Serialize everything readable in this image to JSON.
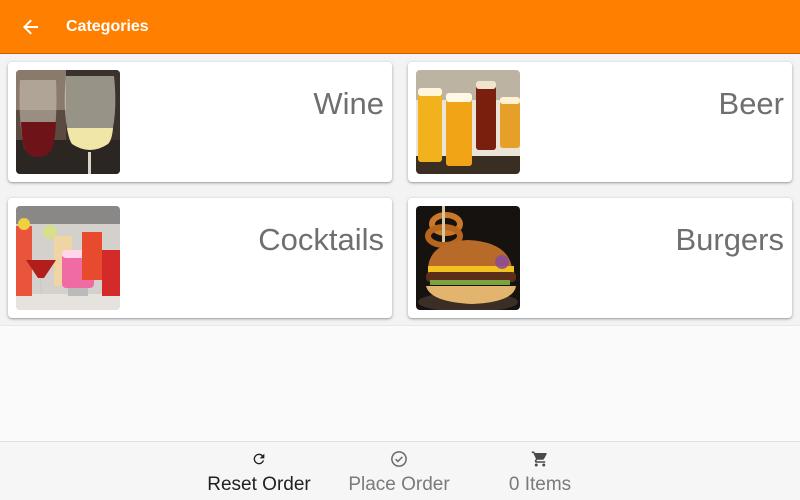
{
  "appbar": {
    "title": "Categories",
    "color": "#ff8000"
  },
  "categories": [
    {
      "label": "Wine",
      "icon": "wine-glasses-photo"
    },
    {
      "label": "Beer",
      "icon": "beer-glasses-photo"
    },
    {
      "label": "Cocktails",
      "icon": "cocktail-glasses-photo"
    },
    {
      "label": "Burgers",
      "icon": "burger-photo"
    }
  ],
  "bottombar": {
    "reset": {
      "label": "Reset Order",
      "icon": "refresh-icon",
      "enabled": true
    },
    "place": {
      "label": "Place Order",
      "icon": "check-circle-icon",
      "enabled": false
    },
    "cart": {
      "label": "0 Items",
      "icon": "cart-icon",
      "enabled": false
    }
  }
}
